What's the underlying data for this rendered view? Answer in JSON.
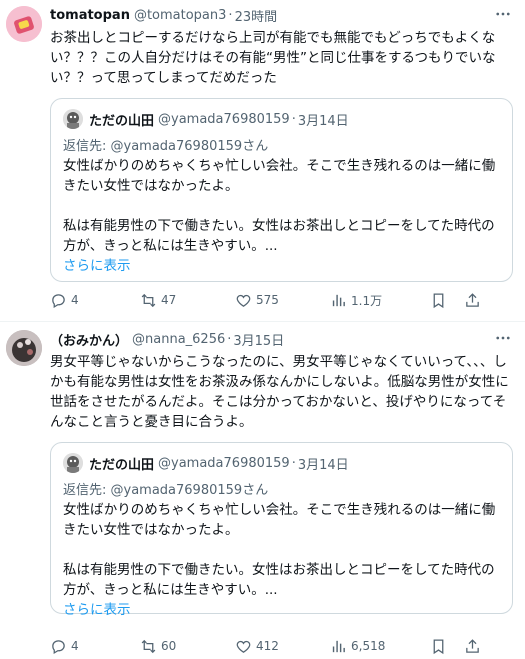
{
  "tweets": [
    {
      "name": "tomatopan",
      "handle": "@tomatopan3",
      "dot": "·",
      "time": "23時間",
      "text": "お茶出しとコピーするだけなら上司が有能でも無能でもどっちでもよくない？？？この人自分だけはその有能“男性”と同じ仕事をするつもりでいない？？って思ってしまってだめだった",
      "quote": {
        "name": "ただの山田",
        "handle": "@yamada76980159",
        "dot": "·",
        "time": "3月14日",
        "reply_to": "返信先: @yamada76980159さん",
        "text": "女性ばかりのめちゃくちゃ忙しい会社。そこで生き残れるのは一緒に働きたい女性ではなかったよ。\n\n私は有能男性の下で働きたい。女性はお茶出しとコピーをしてた時代の方が、きっと私には生きやすい。...",
        "show_more": "さらに表示"
      },
      "stats": {
        "replies": "4",
        "retweets": "47",
        "likes": "575",
        "views": "1.1万"
      }
    },
    {
      "name": "（おみかん）",
      "handle": "@nanna_6256",
      "dot": "·",
      "time": "3月15日",
      "text": "男女平等じゃないからこうなったのに、男女平等じゃなくていいって、、、しかも有能な男性は女性をお茶汲み係なんかにしないよ。低脳な男性が女性に世話をさせたがるんだよ。そこは分かっておかないと、投げやりになってそんなこと言うと憂き目に合うよ。",
      "quote": {
        "name": "ただの山田",
        "handle": "@yamada76980159",
        "dot": "·",
        "time": "3月14日",
        "reply_to": "返信先: @yamada76980159さん",
        "text": "女性ばかりのめちゃくちゃ忙しい会社。そこで生き残れるのは一緒に働きたい女性ではなかったよ。\n\n私は有能男性の下で働きたい。女性はお茶出しとコピーをしてた時代の方が、きっと私には生きやすい。...",
        "show_more": "さらに表示"
      },
      "stats": {
        "replies": "4",
        "retweets": "60",
        "likes": "412",
        "views": "6,518"
      }
    }
  ],
  "colors": {
    "link": "#1d9bf0",
    "muted": "#536471",
    "border": "#cfd9de"
  },
  "icons": [
    "more-icon",
    "reply-icon",
    "retweet-icon",
    "like-icon",
    "views-icon",
    "bookmark-icon",
    "share-icon"
  ]
}
